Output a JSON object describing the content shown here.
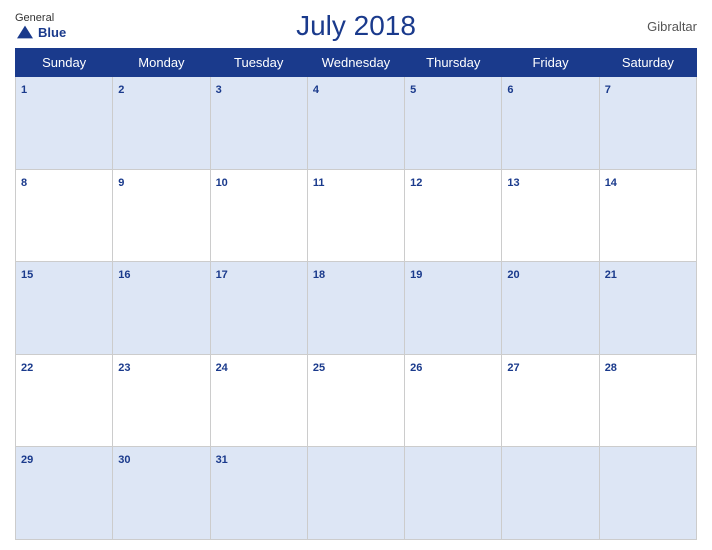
{
  "header": {
    "logo": {
      "general": "General",
      "blue": "Blue",
      "bird_symbol": "▲"
    },
    "title": "July 2018",
    "location": "Gibraltar"
  },
  "weekdays": [
    "Sunday",
    "Monday",
    "Tuesday",
    "Wednesday",
    "Thursday",
    "Friday",
    "Saturday"
  ],
  "weeks": [
    [
      1,
      2,
      3,
      4,
      5,
      6,
      7
    ],
    [
      8,
      9,
      10,
      11,
      12,
      13,
      14
    ],
    [
      15,
      16,
      17,
      18,
      19,
      20,
      21
    ],
    [
      22,
      23,
      24,
      25,
      26,
      27,
      28
    ],
    [
      29,
      30,
      31,
      null,
      null,
      null,
      null
    ]
  ]
}
